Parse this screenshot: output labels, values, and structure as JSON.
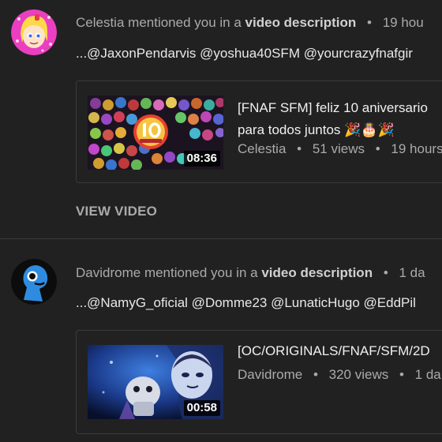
{
  "notifications": [
    {
      "author": "Celestia",
      "action": "mentioned you in a",
      "target": "video description",
      "time": "19 hou",
      "mentions": "...@JaxonPendarvis @yoshua40SFM @yourcrazyfnafgir",
      "video": {
        "title_line1": "[FNAF SFM] feliz 10 aniversario",
        "title_line2": "para todos juntos 🎉🎂🎉",
        "channel": "Celestia",
        "views": "51 views",
        "age": "19 hours",
        "duration": "08:36"
      },
      "view_label": "VIEW VIDEO"
    },
    {
      "author": "Davidrome",
      "action": "mentioned you in a",
      "target": "video description",
      "time": "1 da",
      "mentions": "...@NamyG_oficial @Domme23 @LunaticHugo @EddPil",
      "video": {
        "title_line1": "[OC/ORIGINALS/FNAF/SFM/2D",
        "channel": "Davidrome",
        "views": "320 views",
        "age": "1 da",
        "duration": "00:58"
      }
    }
  ],
  "colors": {
    "background": "#212121",
    "text_primary": "#f0f0f0",
    "text_secondary": "#aaaaaa",
    "border": "#3a3a3a"
  }
}
